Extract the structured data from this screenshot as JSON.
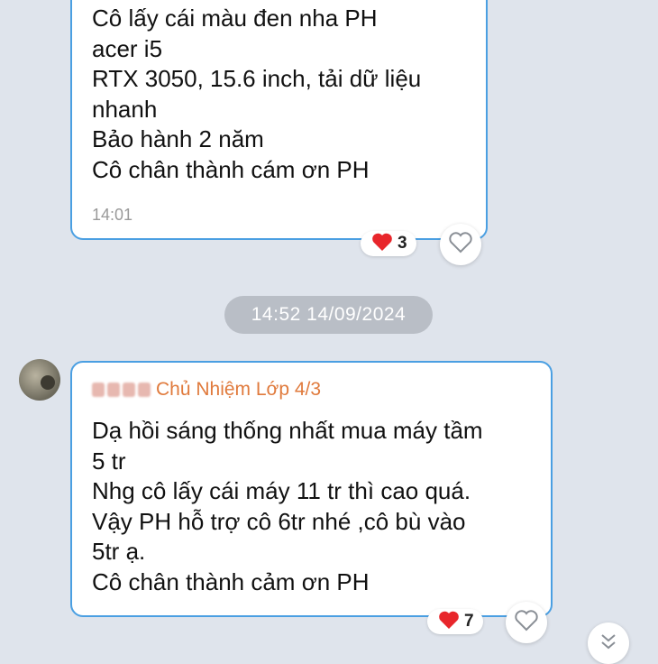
{
  "messages": [
    {
      "lines": [
        "Cô lấy cái màu đen nha PH",
        "acer i5",
        "RTX 3050, 15.6 inch, tải dữ liệu",
        "nhanh",
        "Bảo hành 2 năm",
        "Cô chân thành cám ơn PH"
      ],
      "time": "14:01",
      "reaction_count": "3"
    },
    {
      "sender": "Chủ Nhiệm Lớp 4/3",
      "lines": [
        "Dạ hồi sáng thống nhất mua máy tầm",
        "5 tr",
        "Nhg cô lấy cái máy 11 tr thì cao quá.",
        "Vậy PH hỗ trợ cô 6tr nhé ,cô bù vào",
        "5tr ạ.",
        "Cô chân thành cảm ơn PH"
      ],
      "reaction_count": "7"
    }
  ],
  "date_divider": "14:52 14/09/2024",
  "colors": {
    "bubble_border": "#4a9fe2",
    "sender_name": "#e07a3c",
    "heart": "#e8262b"
  }
}
